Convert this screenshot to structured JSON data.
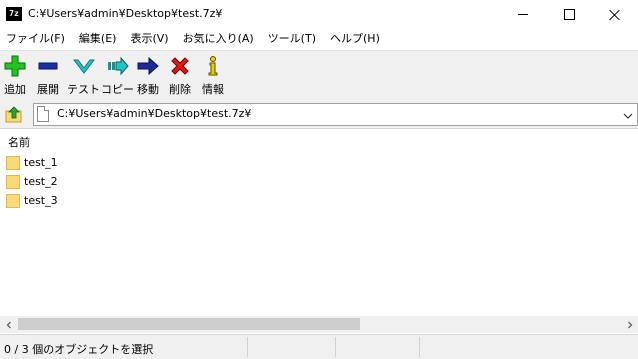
{
  "window": {
    "app_icon_text": "7z",
    "title": "C:¥Users¥admin¥Desktop¥test.7z¥"
  },
  "menu": [
    "ファイル(F)",
    "編集(E)",
    "表示(V)",
    "お気に入り(A)",
    "ツール(T)",
    "ヘルプ(H)"
  ],
  "toolbar": {
    "add": "追加",
    "extract": "展開",
    "test": "テスト",
    "copy": "コピー",
    "move": "移動",
    "delete": "削除",
    "info": "情報"
  },
  "address": {
    "path": "C:¥Users¥admin¥Desktop¥test.7z¥"
  },
  "list": {
    "column_name": "名前",
    "items": [
      "test_1",
      "test_2",
      "test_3"
    ]
  },
  "status": {
    "selection": "0 / 3 個のオブジェクトを選択"
  },
  "colors": {
    "add": "#22c322",
    "extract": "#1c2fa5",
    "test": "#22c5c5",
    "copy": "#1a8f8f",
    "move": "#1c2a9a",
    "delete": "#e01818",
    "info": "#e8d000",
    "folder": "#f9d978"
  }
}
